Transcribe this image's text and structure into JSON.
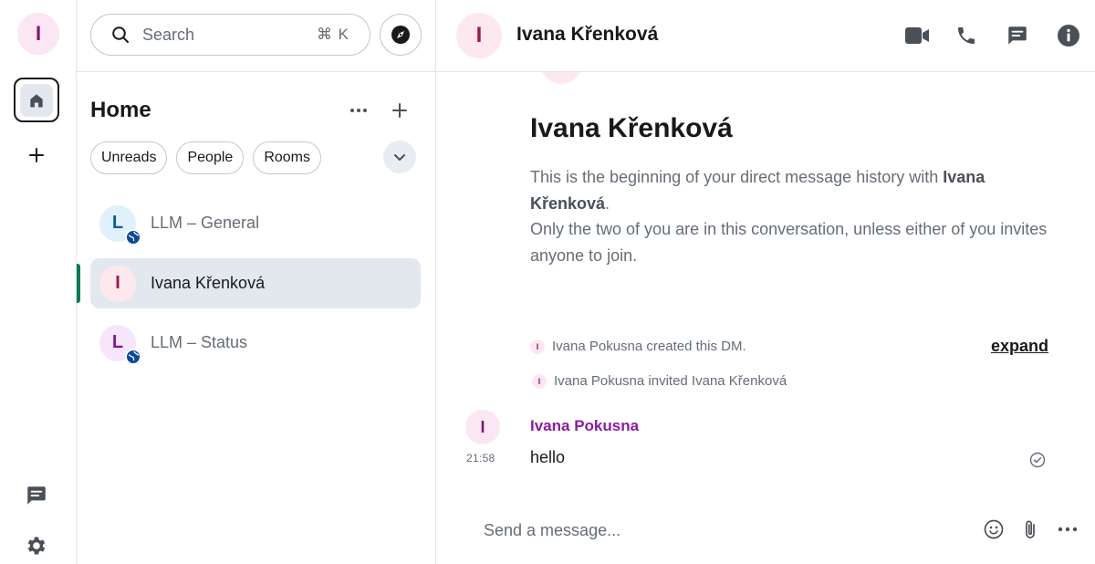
{
  "user": {
    "avatar_letter": "I"
  },
  "spacebar": {
    "home_icon": "home-icon",
    "create_space_icon": "plus-icon",
    "threads_icon": "threads-icon",
    "settings_icon": "gear-icon"
  },
  "room_list": {
    "search": {
      "placeholder": "Search",
      "shortcut": "⌘ K"
    },
    "title": "Home",
    "filters": [
      "Unreads",
      "People",
      "Rooms"
    ],
    "rooms": [
      {
        "name": "LLM – General",
        "avatar_letter": "L",
        "avatar_bg": "#e1f1fb",
        "avatar_fg": "#0b5e9a",
        "public": true,
        "active": false
      },
      {
        "name": "Ivana Křenková",
        "avatar_letter": "I",
        "avatar_bg": "#fde8ee",
        "avatar_fg": "#9b1b4c",
        "public": false,
        "active": true
      },
      {
        "name": "LLM – Status",
        "avatar_letter": "L",
        "avatar_bg": "#f6e6fb",
        "avatar_fg": "#7a1b9b",
        "public": true,
        "active": false
      }
    ]
  },
  "room": {
    "name": "Ivana Křenková",
    "avatar_letter": "I",
    "header_icons": [
      "video-call-icon",
      "voice-call-icon",
      "threads-icon",
      "room-info-icon"
    ]
  },
  "intro": {
    "name": "Ivana Křenková",
    "line1_prefix": "This is the beginning of your direct message history with ",
    "line1_name": "Ivana Křenková",
    "line1_suffix": ".",
    "line2": "Only the two of you are in this conversation, unless either of you invites anyone to join."
  },
  "events": [
    {
      "avatar_letter": "I",
      "text": "Ivana Pokusna created this DM."
    },
    {
      "avatar_letter": "I",
      "text": "Ivana Pokusna invited Ivana Křenková"
    }
  ],
  "expand_label": "expand",
  "message": {
    "avatar_letter": "I",
    "sender": "Ivana Pokusna",
    "time": "21:58",
    "body": "hello"
  },
  "composer": {
    "placeholder": "Send a message...",
    "icons": [
      "emoji-icon",
      "attachment-icon",
      "more-options-icon"
    ]
  },
  "colors": {
    "accent": "#0b7a53",
    "sender": "#8a1ca3"
  }
}
